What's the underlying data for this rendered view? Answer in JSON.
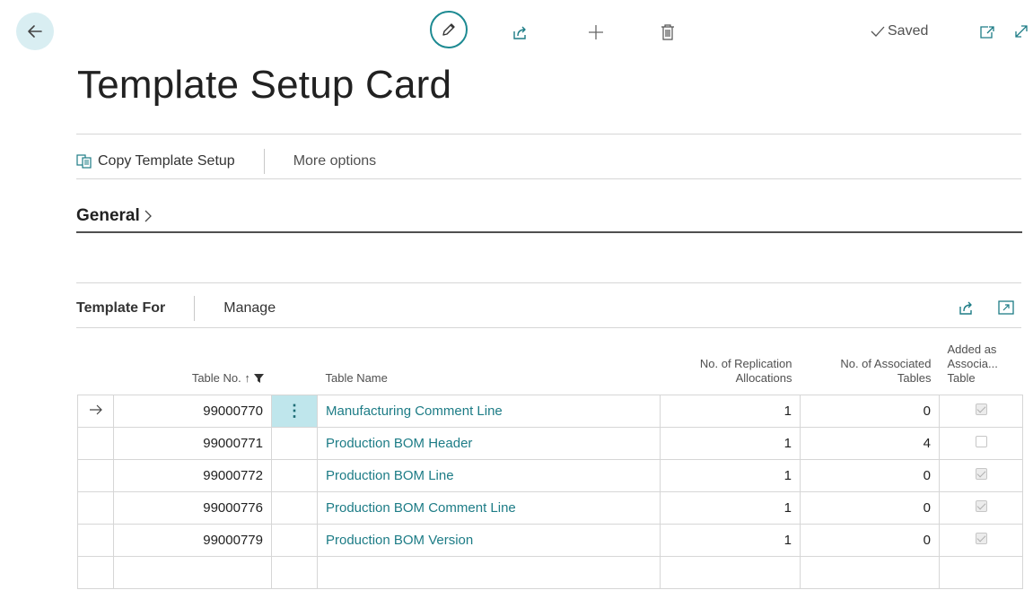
{
  "page": {
    "title": "Template Setup Card"
  },
  "status": {
    "saved_label": "Saved"
  },
  "actions": {
    "copy_label": "Copy Template Setup",
    "more_label": "More options"
  },
  "general": {
    "label": "General"
  },
  "subpage": {
    "title": "Template For",
    "manage_label": "Manage"
  },
  "grid": {
    "columns": {
      "table_no": "Table No. ↑",
      "table_name": "Table Name",
      "replication_1": "No. of Replication",
      "replication_2": "Allocations",
      "associated_1": "No. of Associated",
      "associated_2": "Tables",
      "added_1": "Added as",
      "added_2": "Associa...",
      "added_3": "Table"
    },
    "rows": [
      {
        "table_no": "99000770",
        "table_name": "Manufacturing Comment Line",
        "replication": "1",
        "associated": "0",
        "added": true
      },
      {
        "table_no": "99000771",
        "table_name": "Production BOM Header",
        "replication": "1",
        "associated": "4",
        "added": false
      },
      {
        "table_no": "99000772",
        "table_name": "Production BOM Line",
        "replication": "1",
        "associated": "0",
        "added": true
      },
      {
        "table_no": "99000776",
        "table_name": "Production BOM Comment Line",
        "replication": "1",
        "associated": "0",
        "added": true
      },
      {
        "table_no": "99000779",
        "table_name": "Production BOM Version",
        "replication": "1",
        "associated": "0",
        "added": true
      }
    ]
  },
  "icons": {
    "back": "arrow-left-icon",
    "edit": "pencil-icon",
    "share": "share-icon",
    "new": "plus-icon",
    "delete": "trash-icon",
    "saved": "checkmark-icon",
    "open_new_window": "open-new-window-icon",
    "expand": "expand-icon",
    "copy": "copy-icon",
    "chevron": "chevron-right-icon",
    "filter": "filter-icon",
    "row_marker": "arrow-right-icon",
    "row_menu": "more-vertical-icon",
    "fullscreen": "fullscreen-icon"
  },
  "colors": {
    "accent": "#1d7c86",
    "selection": "#bfe6ec",
    "back_bg": "#d9eef2"
  }
}
